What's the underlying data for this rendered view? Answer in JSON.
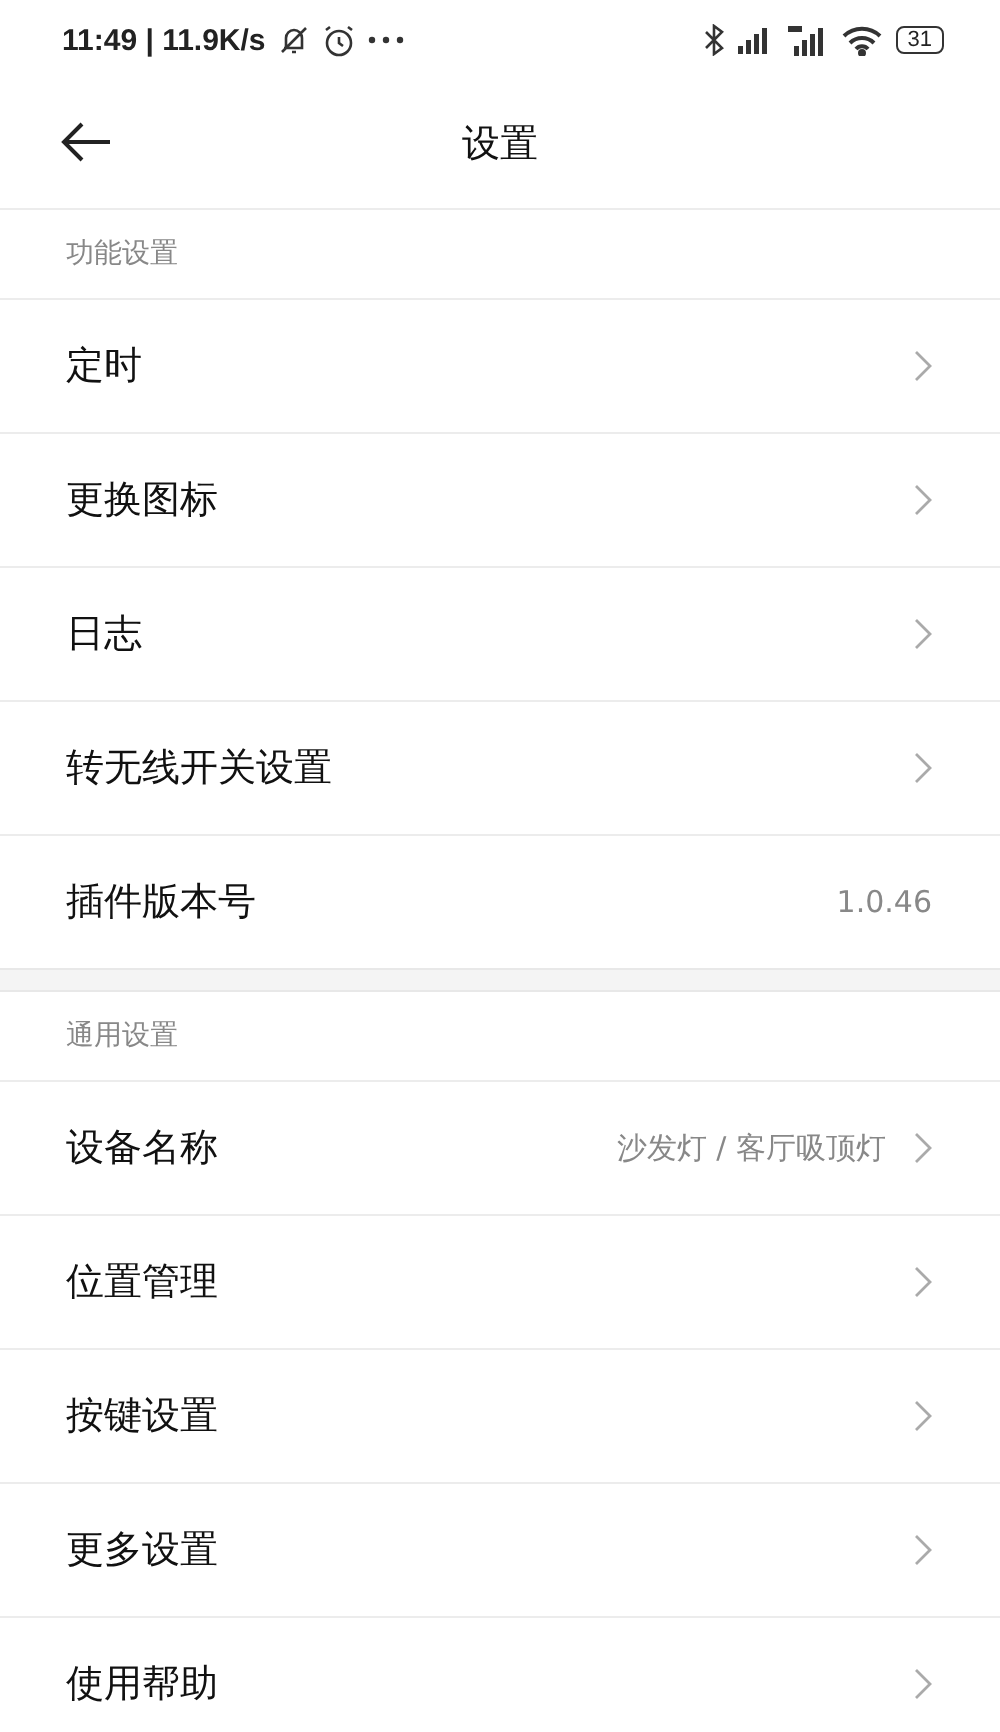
{
  "status_bar": {
    "time": "11:49 | 11.9K/s",
    "battery": "31"
  },
  "header": {
    "title": "设置"
  },
  "sections": [
    {
      "title": "功能设置",
      "items": [
        {
          "kind": "nav",
          "label": "定时"
        },
        {
          "kind": "nav",
          "label": "更换图标"
        },
        {
          "kind": "nav",
          "label": "日志"
        },
        {
          "kind": "nav",
          "label": "转无线开关设置"
        },
        {
          "kind": "info",
          "label": "插件版本号",
          "value": "1.0.46"
        }
      ]
    },
    {
      "title": "通用设置",
      "items": [
        {
          "kind": "nav",
          "label": "设备名称",
          "value": "沙发灯 / 客厅吸顶灯"
        },
        {
          "kind": "nav",
          "label": "位置管理"
        },
        {
          "kind": "nav",
          "label": "按键设置"
        },
        {
          "kind": "nav",
          "label": "更多设置"
        },
        {
          "kind": "nav",
          "label": "使用帮助"
        }
      ]
    }
  ]
}
